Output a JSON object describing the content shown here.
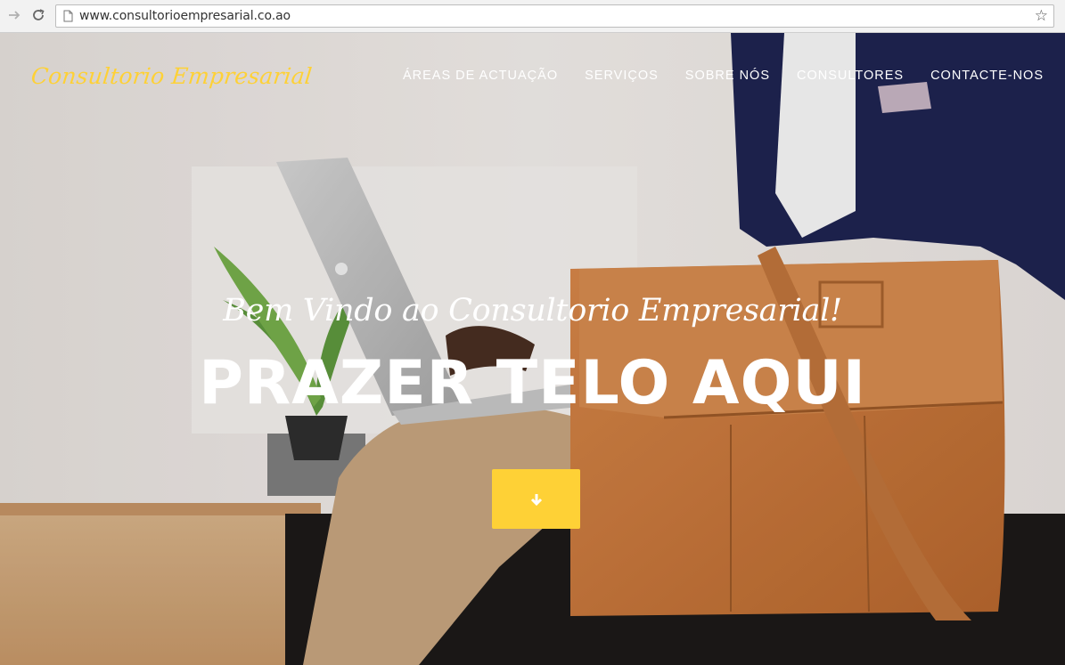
{
  "browser": {
    "url": "www.consultorioempresarial.co.ao"
  },
  "navbar": {
    "brand": "Consultorio Empresarial",
    "items": [
      {
        "label": "ÁREAS DE ACTUAÇÃO"
      },
      {
        "label": "SERVIÇOS"
      },
      {
        "label": "SOBRE NÓS"
      },
      {
        "label": "CONSULTORES"
      },
      {
        "label": "CONTACTE-NOS"
      }
    ]
  },
  "hero": {
    "lead": "Bem Vindo ao Consultorio Empresarial!",
    "heading": "PRAZER TELO AQUI"
  },
  "colors": {
    "accent": "#fed136",
    "text_light": "#ffffff"
  },
  "icons": {
    "back": "arrow-right-icon",
    "reload": "reload-icon",
    "page": "page-icon",
    "bookmark": "star-icon",
    "scroll": "arrow-down-icon"
  }
}
